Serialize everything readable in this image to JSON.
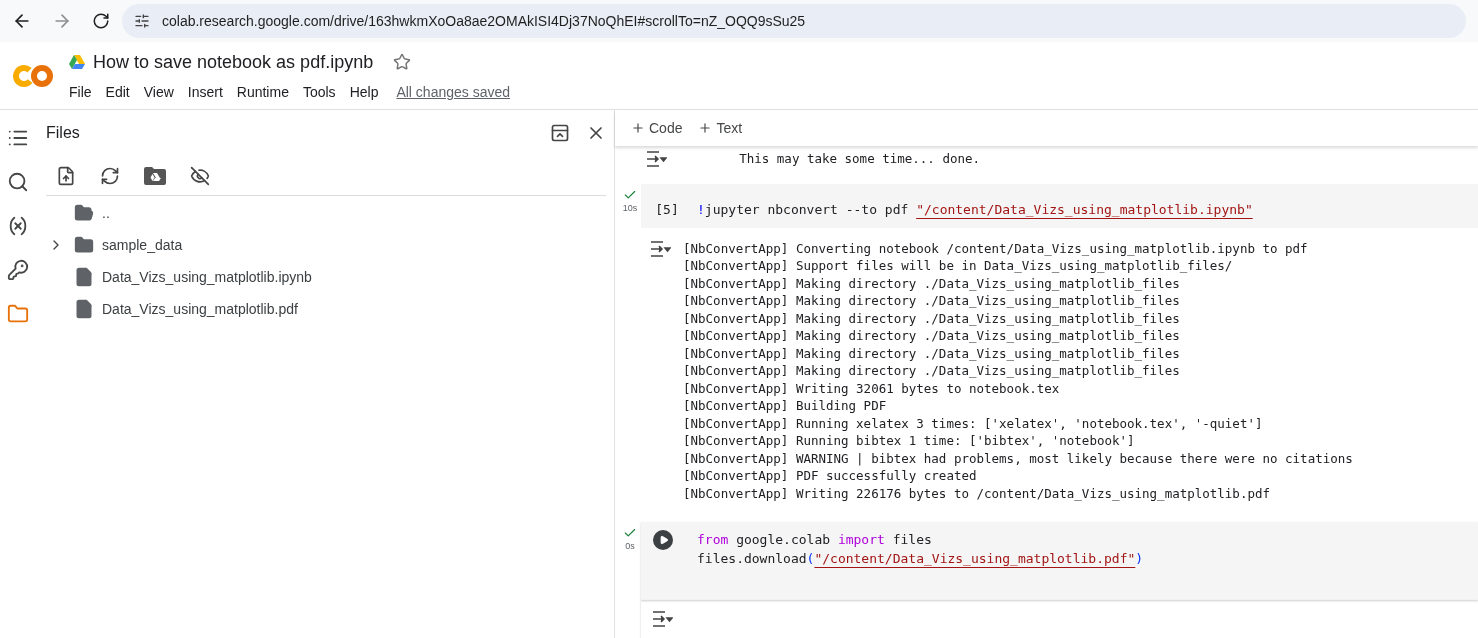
{
  "browser": {
    "url": "colab.research.google.com/drive/163hwkmXoOa8ae2OMAkISI4Dj37NoQhEI#scrollTo=nZ_OQQ9sSu25"
  },
  "header": {
    "title": "How to save notebook as pdf.ipynb",
    "starred": false,
    "menu": [
      "File",
      "Edit",
      "View",
      "Insert",
      "Runtime",
      "Tools",
      "Help"
    ],
    "save_status": "All changes saved"
  },
  "rail": [
    {
      "kind": "toc",
      "selected": false
    },
    {
      "kind": "search",
      "selected": false
    },
    {
      "kind": "variables",
      "selected": false
    },
    {
      "kind": "secrets",
      "selected": false
    },
    {
      "kind": "files",
      "selected": true
    }
  ],
  "files_panel": {
    "title": "Files",
    "tree": [
      {
        "kind": "parent",
        "name": ".."
      },
      {
        "kind": "folder",
        "name": "sample_data",
        "expanded": false
      },
      {
        "kind": "file",
        "name": "Data_Vizs_using_matplotlib.ipynb"
      },
      {
        "kind": "file",
        "name": "Data_Vizs_using_matplotlib.pdf"
      }
    ]
  },
  "toolbar": [
    "Code",
    "Text"
  ],
  "prev_output": [
    "        This may take some time... done."
  ],
  "cells": [
    {
      "kind": "prompt",
      "prompt": "[5]",
      "done": true,
      "duration": "10s",
      "code": [
        [
          {
            "kind": "magic",
            "text": "!"
          },
          {
            "kind": "plain",
            "text": "jupyter nbconvert --to pdf "
          },
          {
            "kind": "string",
            "text": "\"/content/Data_Vizs_using_matplotlib.ipynb\""
          }
        ]
      ],
      "output": [
        "[NbConvertApp] Converting notebook /content/Data_Vizs_using_matplotlib.ipynb to pdf",
        "[NbConvertApp] Support files will be in Data_Vizs_using_matplotlib_files/",
        "[NbConvertApp] Making directory ./Data_Vizs_using_matplotlib_files",
        "[NbConvertApp] Making directory ./Data_Vizs_using_matplotlib_files",
        "[NbConvertApp] Making directory ./Data_Vizs_using_matplotlib_files",
        "[NbConvertApp] Making directory ./Data_Vizs_using_matplotlib_files",
        "[NbConvertApp] Making directory ./Data_Vizs_using_matplotlib_files",
        "[NbConvertApp] Making directory ./Data_Vizs_using_matplotlib_files",
        "[NbConvertApp] Writing 32061 bytes to notebook.tex",
        "[NbConvertApp] Building PDF",
        "[NbConvertApp] Running xelatex 3 times: ['xelatex', 'notebook.tex', '-quiet']",
        "[NbConvertApp] Running bibtex 1 time: ['bibtex', 'notebook']",
        "[NbConvertApp] WARNING | bibtex had problems, most likely because there were no citations",
        "[NbConvertApp] PDF successfully created",
        "[NbConvertApp] Writing 226176 bytes to /content/Data_Vizs_using_matplotlib.pdf"
      ]
    },
    {
      "kind": "run",
      "done": true,
      "duration": "0s",
      "code": [
        [
          {
            "kind": "keyword",
            "text": "from"
          },
          {
            "kind": "plain",
            "text": " google.colab "
          },
          {
            "kind": "keyword",
            "text": "import"
          },
          {
            "kind": "plain",
            "text": " files"
          }
        ],
        [
          {
            "kind": "plain",
            "text": "files.download"
          },
          {
            "kind": "paren",
            "text": "("
          },
          {
            "kind": "string",
            "text": "\"/content/Data_Vizs_using_matplotlib.pdf\""
          },
          {
            "kind": "paren",
            "text": ")"
          }
        ]
      ],
      "has_output": true
    }
  ]
}
